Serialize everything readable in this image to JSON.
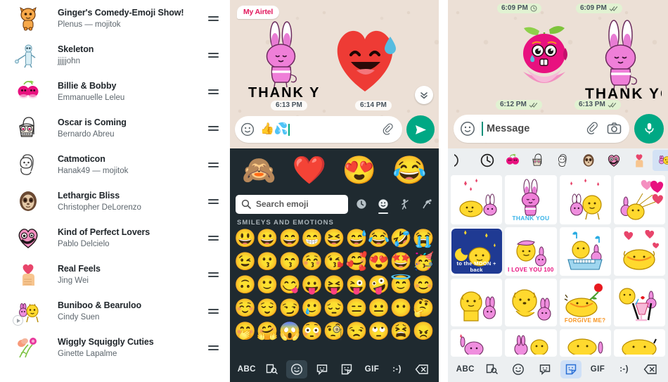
{
  "left_panel": {
    "name": "sticker-pack-list",
    "packs": [
      {
        "title": "Ginger's Comedy-Emoji Show!",
        "author": "Plenus — mojitok",
        "icon": "orange-cat-icon",
        "has_play_badge": false
      },
      {
        "title": "Skeleton",
        "author": "jjjjjohn",
        "icon": "skeleton-icon",
        "has_play_badge": false
      },
      {
        "title": "Billie & Bobby",
        "author": "Emmanuelle Leleu",
        "icon": "cherries-icon",
        "has_play_badge": false
      },
      {
        "title": "Oscar is Coming",
        "author": "Bernardo Abreu",
        "icon": "basket-face-icon",
        "has_play_badge": false
      },
      {
        "title": "Catmoticon",
        "author": "Hanak49 — mojitok",
        "icon": "white-cat-icon",
        "has_play_badge": false
      },
      {
        "title": "Lethargic Bliss",
        "author": "Christopher DeLorenzo",
        "icon": "sloth-icon",
        "has_play_badge": false
      },
      {
        "title": "Kind of Perfect Lovers",
        "author": "Pablo Delcielo",
        "icon": "pink-heart-face-icon",
        "has_play_badge": false
      },
      {
        "title": "Real Feels",
        "author": "Jing Wei",
        "icon": "hand-heart-icon",
        "has_play_badge": false
      },
      {
        "title": "Buniboo & Bearuloo",
        "author": "Cindy Suen",
        "icon": "yellow-bear-bunny-icon",
        "has_play_badge": true
      },
      {
        "title": "Wiggly Squiggly Cuties",
        "author": "Ginette Lapalme",
        "icon": "flowers-icon",
        "has_play_badge": false
      }
    ],
    "reorder_handle_label": "="
  },
  "mid_panel": {
    "name": "whatsapp-chat-with-emoji-keyboard",
    "chat": {
      "contact_badge": "My Airtel",
      "messages": [
        {
          "type": "sticker",
          "content": "bunny-thank-you-sticker",
          "caption": "THANK YOU",
          "time": "6:13 PM"
        },
        {
          "type": "sticker",
          "content": "heart-sweat-smile-sticker",
          "caption": "",
          "time": "6:14 PM"
        }
      ],
      "scroll_down_icon": "chevron-double-down-icon"
    },
    "input": {
      "emoji_icon": "smiley-icon",
      "value": "👍💦",
      "placeholder": "",
      "attach_icon": "paperclip-icon",
      "send_icon": "send-icon"
    },
    "keyboard": {
      "recent_emojis": [
        "🙈",
        "❤️",
        "😍",
        "😂"
      ],
      "recent_emoji_names": [
        "monkey-sweat",
        "heart-sweat-smile",
        "heart-eyes-sweat",
        "tears-of-joy"
      ],
      "search": {
        "icon": "search-icon",
        "placeholder": "Search emoji"
      },
      "categories": [
        {
          "name": "recent-category",
          "icon": "clock-icon",
          "selected": false
        },
        {
          "name": "smileys-category",
          "icon": "smiley-icon",
          "selected": true
        },
        {
          "name": "people-category",
          "icon": "person-icon",
          "selected": false
        },
        {
          "name": "nature-category",
          "icon": "plant-animal-icon",
          "selected": false
        },
        {
          "name": "food-category",
          "icon": "cup-icon",
          "selected": false
        }
      ],
      "section_label": "SMILEYS AND EMOTIONS",
      "emoji_rows": [
        [
          "😃",
          "😀",
          "😄",
          "😁",
          "😆",
          "😅",
          "😂",
          "🤣",
          "😭"
        ],
        [
          "😉",
          "😗",
          "😙",
          "😚",
          "😘",
          "🥰",
          "😍",
          "🤩",
          "🥳"
        ],
        [
          "🙃",
          "🙂",
          "😋",
          "😛",
          "😝",
          "😜",
          "🤪",
          "😇",
          "😊"
        ],
        [
          "☺️",
          "😌",
          "😏",
          "🥲",
          "😔",
          "😑",
          "😐",
          "😶",
          "🤔"
        ],
        [
          "🤭",
          "🤗",
          "😱",
          "😳",
          "🧐",
          "😒",
          "🙄",
          "😫",
          "😠"
        ]
      ],
      "bottom_bar": [
        {
          "label": "ABC",
          "name": "abc-key",
          "icon": "",
          "selected": false
        },
        {
          "label": "",
          "name": "sticker-search-key",
          "icon": "sticker-search-icon",
          "selected": false
        },
        {
          "label": "",
          "name": "emoji-key",
          "icon": "smiley-icon",
          "selected": true
        },
        {
          "label": "",
          "name": "avatar-sticker-key",
          "icon": "chat-smiley-icon",
          "selected": false
        },
        {
          "label": "",
          "name": "sticker-key",
          "icon": "sticker-icon",
          "selected": false
        },
        {
          "label": "GIF",
          "name": "gif-key",
          "icon": "",
          "selected": false
        },
        {
          "label": ":-)",
          "name": "emoticon-key",
          "icon": "",
          "selected": false
        },
        {
          "label": "",
          "name": "backspace-key",
          "icon": "backspace-icon",
          "selected": false
        }
      ]
    }
  },
  "right_panel": {
    "name": "whatsapp-chat-with-sticker-picker",
    "chat": {
      "messages": [
        {
          "type": "sticker",
          "content": "crying-dragonfruit-sticker",
          "time": "6:12 PM",
          "status": "delivered"
        },
        {
          "type": "sticker",
          "content": "bunny-thank-you-sticker",
          "caption": "THANK YOU",
          "time": "6:13 PM",
          "status": "delivered"
        }
      ],
      "top_pills": [
        {
          "time": "6:09 PM",
          "status": "pending"
        },
        {
          "time": "6:09 PM",
          "status": "delivered"
        }
      ]
    },
    "input": {
      "emoji_icon": "smiley-icon",
      "value": "",
      "placeholder": "Message",
      "attach_icon": "paperclip-icon",
      "camera_icon": "camera-icon",
      "mic_icon": "microphone-icon"
    },
    "sticker_tabs": [
      {
        "name": "tab-partial-left",
        "icon": "partial-icon",
        "selected": false
      },
      {
        "name": "tab-recent",
        "icon": "clock-icon",
        "selected": false
      },
      {
        "name": "tab-billie-bobby",
        "icon": "cherries-icon",
        "selected": false
      },
      {
        "name": "tab-oscar-is-coming",
        "icon": "basket-face-icon",
        "selected": false
      },
      {
        "name": "tab-catmoticon",
        "icon": "white-cat-icon",
        "selected": false
      },
      {
        "name": "tab-lethargic-bliss",
        "icon": "sloth-icon",
        "selected": false
      },
      {
        "name": "tab-kind-of-perfect-lovers",
        "icon": "pink-heart-face-icon",
        "selected": false
      },
      {
        "name": "tab-real-feels",
        "icon": "hand-heart-icon",
        "selected": false
      },
      {
        "name": "tab-buniboo-bearuloo",
        "icon": "yellow-bear-bunny-icon",
        "selected": true
      }
    ],
    "stickers": [
      {
        "name": "bear-bunny-lying-hearts",
        "caption": ""
      },
      {
        "name": "pink-bunny-thank-you",
        "caption": "THANK YOU"
      },
      {
        "name": "bunny-bear-hearts",
        "caption": ""
      },
      {
        "name": "bear-heart-balloons",
        "caption": ""
      },
      {
        "name": "bear-moon-night",
        "caption": "to the MOON + back"
      },
      {
        "name": "bear-bunny-love",
        "caption": "I LOVE YOU 100"
      },
      {
        "name": "bear-bunny-piano",
        "caption": ""
      },
      {
        "name": "bear-hearts-hug",
        "caption": ""
      },
      {
        "name": "bear-bunny-standing",
        "caption": ""
      },
      {
        "name": "bear-hugging-bunny",
        "caption": ""
      },
      {
        "name": "bear-rose-forgive",
        "caption": "FORGIVE ME?"
      },
      {
        "name": "bear-bunny-milkshake",
        "caption": ""
      },
      {
        "name": "bunny-pink-row4a",
        "caption": ""
      },
      {
        "name": "bear-bunny-row4b",
        "caption": ""
      },
      {
        "name": "bear-row4c",
        "caption": ""
      },
      {
        "name": "bear-row4d",
        "caption": ""
      }
    ],
    "bottom_bar": [
      {
        "label": "ABC",
        "name": "abc-key",
        "icon": "",
        "selected": false
      },
      {
        "label": "",
        "name": "sticker-search-key",
        "icon": "sticker-search-icon",
        "selected": false
      },
      {
        "label": "",
        "name": "emoji-key",
        "icon": "smiley-icon",
        "selected": false
      },
      {
        "label": "",
        "name": "avatar-sticker-key",
        "icon": "chat-smiley-icon",
        "selected": false
      },
      {
        "label": "",
        "name": "sticker-key",
        "icon": "sticker-icon",
        "selected": true
      },
      {
        "label": "GIF",
        "name": "gif-key",
        "icon": "",
        "selected": false
      },
      {
        "label": ":-)",
        "name": "emoticon-key",
        "icon": "",
        "selected": false
      },
      {
        "label": "",
        "name": "backspace-key",
        "icon": "backspace-icon",
        "selected": false
      }
    ]
  },
  "colors": {
    "whatsapp_green": "#00a884",
    "chat_bg": "#ece0d6",
    "keyboard_dark": "#1f2a30",
    "picker_light": "#eceff1",
    "selected_tab": "#d3e2f5",
    "airtel_pink": "#e2185d",
    "sticker_text_blue": "#39b3e8"
  }
}
